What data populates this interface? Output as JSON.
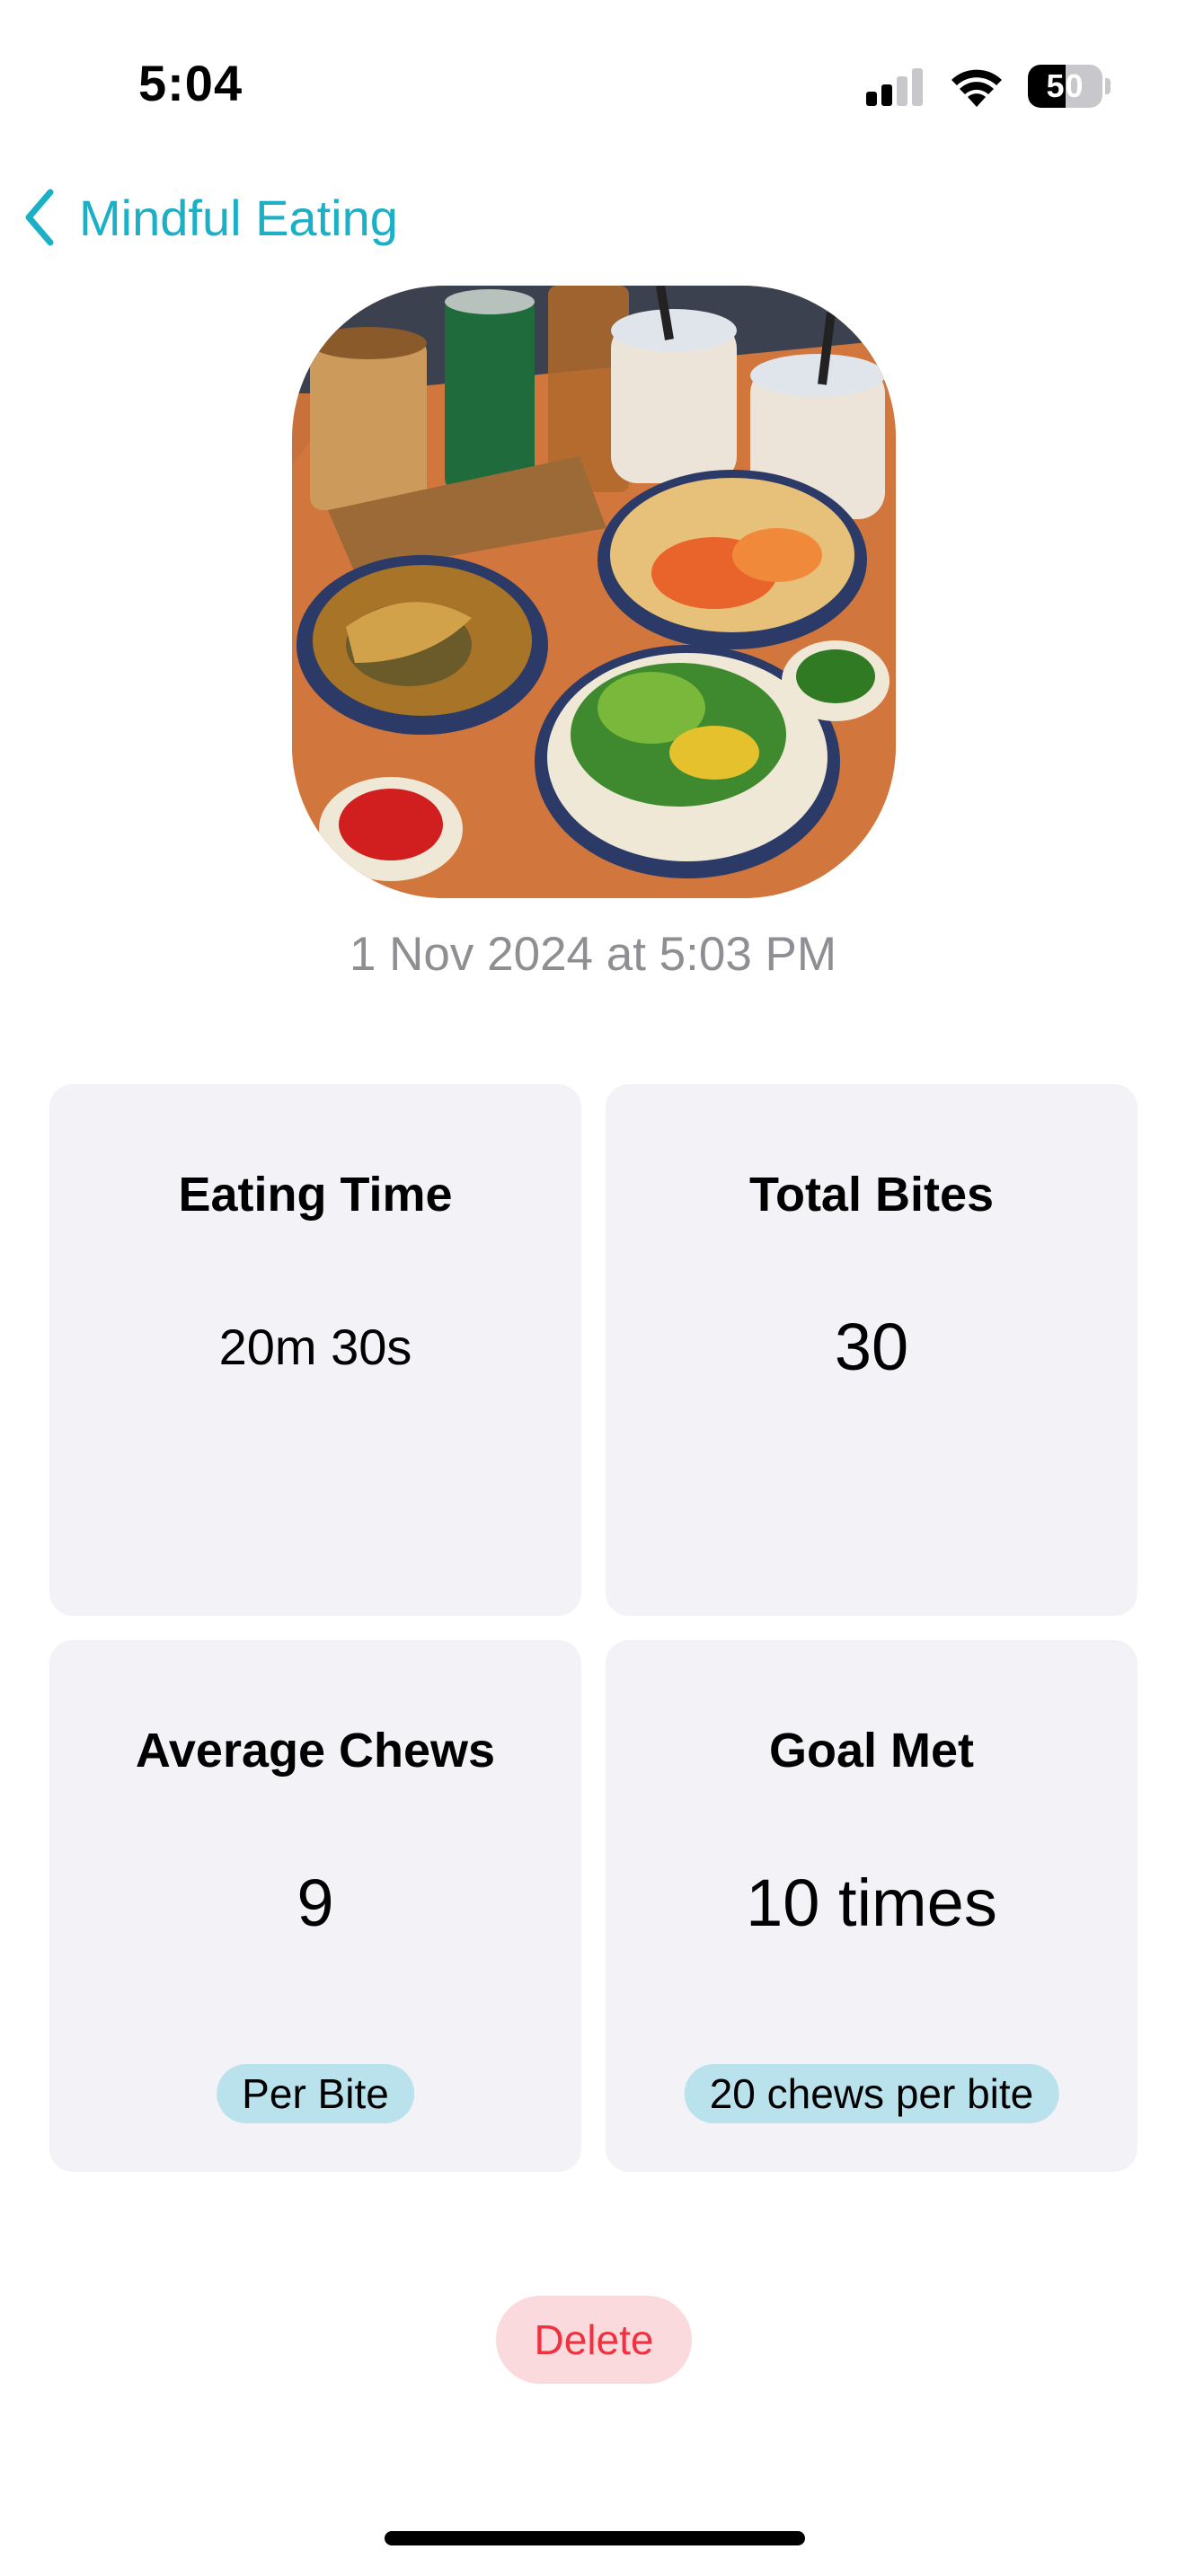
{
  "status_bar": {
    "time": "5:04",
    "battery_level": "50",
    "battery_fraction": 0.5,
    "icons": [
      "signal-icon",
      "wifi-icon",
      "battery-icon"
    ]
  },
  "nav": {
    "back_label": "Mindful Eating",
    "back_icon": "chevron-left-icon",
    "accent_color": "#1bb0c6"
  },
  "meal": {
    "photo": "meal-photo",
    "timestamp": "1 Nov 2024 at 5:03 PM"
  },
  "stats": {
    "eating_time": {
      "title": "Eating Time",
      "value": "20m 30s"
    },
    "total_bites": {
      "title": "Total Bites",
      "value": "30"
    },
    "average_chews": {
      "title": "Average Chews",
      "value": "9",
      "pill": "Per Bite"
    },
    "goal_met": {
      "title": "Goal Met",
      "value": "10 times",
      "pill": "20 chews per bite"
    }
  },
  "actions": {
    "delete_label": "Delete",
    "delete_color": "#f0313f"
  }
}
